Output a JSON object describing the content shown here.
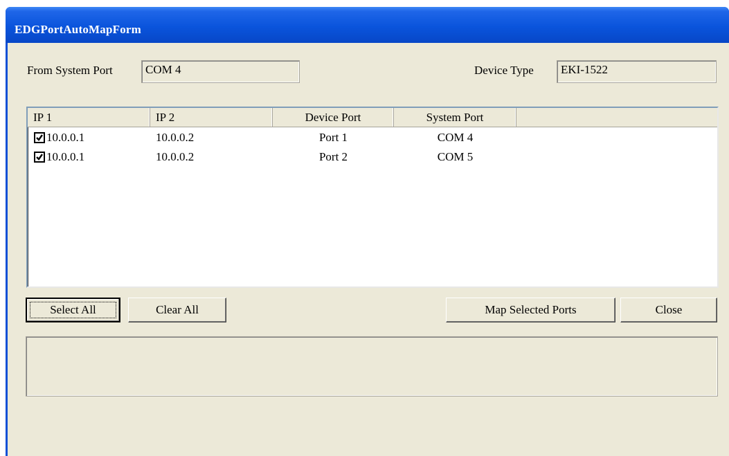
{
  "window": {
    "title": "EDGPortAutoMapForm"
  },
  "form": {
    "from_port_label": "From System Port",
    "from_port_value": "COM 4",
    "device_type_label": "Device Type",
    "device_type_value": "EKI-1522"
  },
  "table": {
    "columns": [
      "IP 1",
      "IP 2",
      "Device Port",
      "System Port",
      ""
    ],
    "rows": [
      {
        "checked": true,
        "ip1": "10.0.0.1",
        "ip2": "10.0.0.2",
        "device_port": "Port 1",
        "system_port": "COM 4"
      },
      {
        "checked": true,
        "ip1": "10.0.0.1",
        "ip2": "10.0.0.2",
        "device_port": "Port 2",
        "system_port": "COM 5"
      }
    ]
  },
  "buttons": {
    "select_all": "Select All",
    "clear_all": "Clear All",
    "map_selected": "Map Selected Ports",
    "close": "Close"
  },
  "status": {
    "text": ""
  }
}
